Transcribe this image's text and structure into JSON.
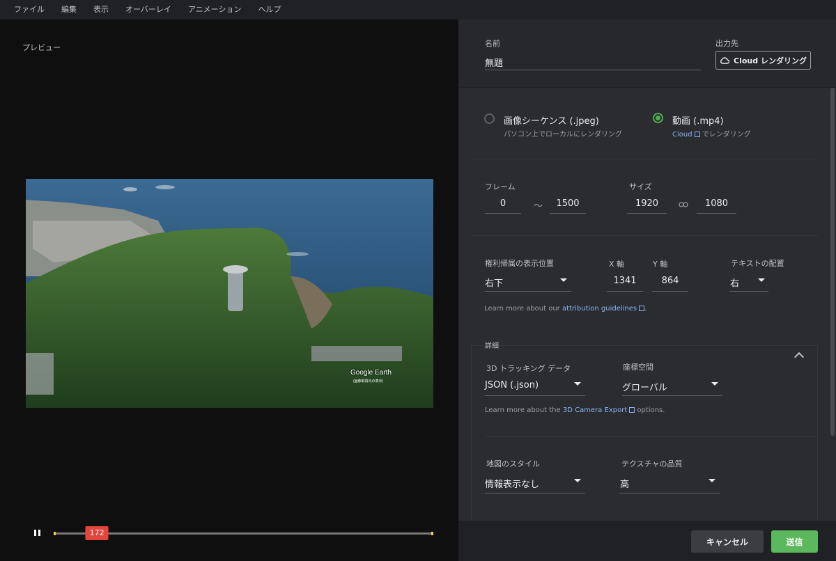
{
  "menu": [
    "ファイル",
    "編集",
    "表示",
    "オーバーレイ",
    "アニメーション",
    "ヘルプ"
  ],
  "preview": {
    "label": "プレビュー",
    "watermark": "Google Earth",
    "watermark_sub": "(画像取得元の表示)",
    "current_frame": "172",
    "progress": 0.114
  },
  "panel": {
    "name_label": "名前",
    "name_value": "無題",
    "output_label": "出力先",
    "cloud_button": "Cloud レンダリング",
    "output_options": [
      {
        "title": "画像シーケンス (.jpeg)",
        "sub": "パソコン上でローカルにレンダリング",
        "selected": false
      },
      {
        "title": "動画 (.mp4)",
        "sub_link": "Cloud",
        "sub": "でレンダリング",
        "selected": true
      }
    ],
    "frame_label": "フレーム",
    "frame_start": "0",
    "frame_sep": "〜",
    "frame_end": "1500",
    "size_label": "サイズ",
    "width": "1920",
    "height": "1080",
    "attribution_pos_label": "権利帰属の表示位置",
    "attribution_pos_value": "右下",
    "x_label": "X 軸",
    "x_value": "1341",
    "y_label": "Y 軸",
    "y_value": "864",
    "text_align_label": "テキストの配置",
    "text_align_value": "右",
    "attribution_help_prefix": "Learn more about our ",
    "attribution_help_link": "attribution guidelines",
    "attribution_help_suffix": ".",
    "details_label": "詳細",
    "tracking_label": "3D トラッキング データ",
    "tracking_value": "JSON (.json)",
    "coord_label": "座標空間",
    "coord_value": "グローバル",
    "camera_help_prefix": "Learn more about the ",
    "camera_help_link": "3D Camera Export",
    "camera_help_suffix": " options.",
    "map_style_label": "地図のスタイル",
    "map_style_value": "情報表示なし",
    "texture_label": "テクスチャの品質",
    "texture_value": "高",
    "cancel_button": "キャンセル",
    "submit_button": "送信"
  },
  "colors": {
    "accent_green": "#5cb85c",
    "radio_green": "#4caf50",
    "thumb_red": "#e2453c",
    "link_blue": "#8ab4f8"
  }
}
